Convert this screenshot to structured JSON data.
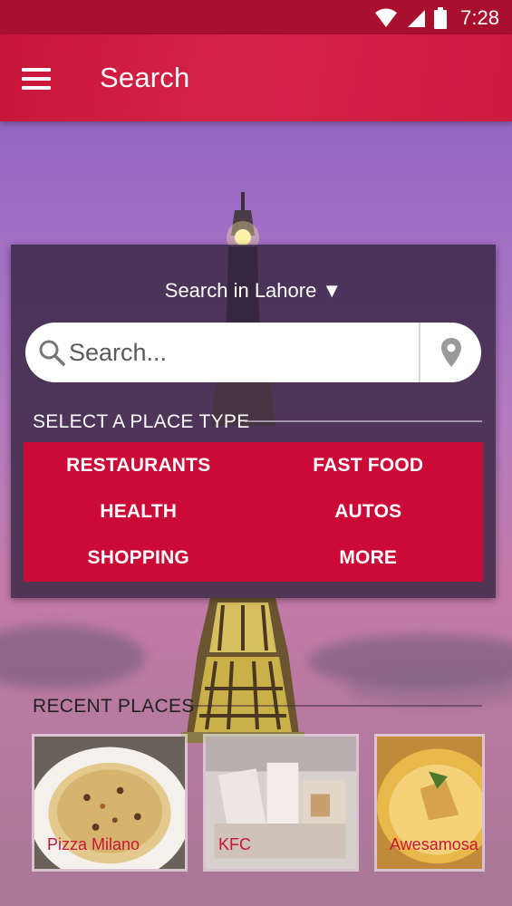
{
  "status_bar": {
    "time": "7:28",
    "icons": [
      "wifi-icon",
      "signal-icon",
      "battery-icon"
    ]
  },
  "app_bar": {
    "title": "Search",
    "menu_icon": "hamburger-menu-icon"
  },
  "search": {
    "city_selector": "Search in Lahore ▼",
    "placeholder": "Search...",
    "value": "",
    "search_icon": "magnifier-icon",
    "location_icon": "map-pin-icon"
  },
  "place_types": {
    "heading": "SELECT A PLACE TYPE",
    "items": [
      {
        "label": "RESTAURANTS"
      },
      {
        "label": "FAST FOOD"
      },
      {
        "label": "HEALTH"
      },
      {
        "label": "AUTOS"
      },
      {
        "label": "SHOPPING"
      },
      {
        "label": "MORE"
      }
    ]
  },
  "recent_places": {
    "heading": "RECENT PLACES",
    "items": [
      {
        "name": "Pizza Milano"
      },
      {
        "name": "KFC"
      },
      {
        "name": "Awesamosa"
      }
    ]
  },
  "colors": {
    "primary": "#c8153a",
    "status_bar": "#a8102e",
    "card_overlay": "#34243f",
    "type_grid": "#cc0a38"
  }
}
